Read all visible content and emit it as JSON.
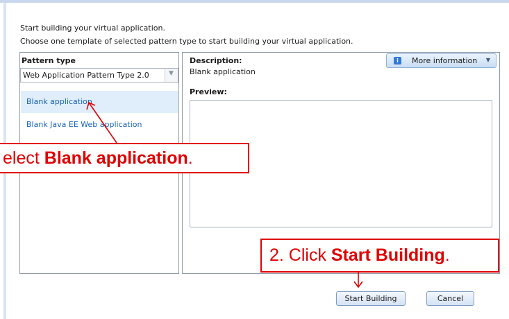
{
  "intro": {
    "line1": "Start building your virtual application.",
    "line2": "Choose one template of selected pattern type to start building your virtual application."
  },
  "left_panel": {
    "header": "Pattern type",
    "select": {
      "value": "Web Application Pattern Type 2.0"
    },
    "items": [
      {
        "label": "Blank application",
        "selected": true
      },
      {
        "label": "Blank Java EE Web application",
        "selected": false
      }
    ]
  },
  "right_panel": {
    "description_label": "Description:",
    "description_value": "Blank application",
    "preview_label": "Preview:",
    "more_info_label": "More information",
    "more_info_icon": "info-icon"
  },
  "buttons": {
    "start_building": "Start Building",
    "cancel": "Cancel"
  },
  "callouts": {
    "one_prefix": "elect ",
    "one_bold": "Blank application",
    "one_suffix": ".",
    "two_prefix": "2. Click ",
    "two_bold": "Start Building",
    "two_suffix": "."
  },
  "colors": {
    "accent_link": "#1762b8",
    "callout_red": "#e00000",
    "selection_bg": "#dfeefa"
  }
}
